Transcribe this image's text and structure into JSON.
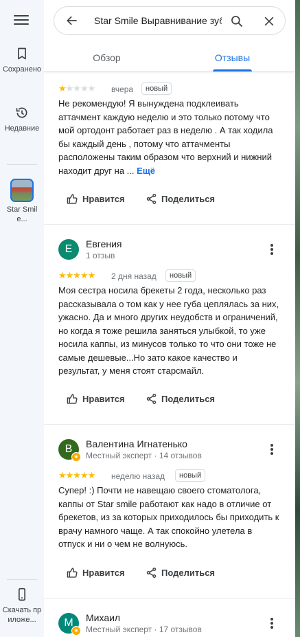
{
  "rail": {
    "saved_label": "Сохранено",
    "recent_label": "Недавние",
    "place_label": "Star Smile...",
    "download_label": "Скачать приложе..."
  },
  "search": {
    "value": "Star Smile Выравнивание зуб"
  },
  "tabs": [
    {
      "label": "Обзор",
      "active": false
    },
    {
      "label": "Отзывы",
      "active": true
    }
  ],
  "actions": {
    "like": "Нравится",
    "share": "Поделиться"
  },
  "reviews": [
    {
      "rating": 1,
      "when": "вчера",
      "tag": "новый",
      "text": "Не рекомендую! Я вынуждена подклеивать аттачмент каждую неделю и это только потому что мой ортодонт работает раз в неделю . А так ходила бы каждый день , потому что аттачменты расположены таким образом что верхний и нижний находит друг на ...",
      "more": "Ещё"
    },
    {
      "name": "Евгения",
      "initial": "Е",
      "sub": "1 отзыв",
      "rating": 5,
      "when": "2 дня назад",
      "tag": "новый",
      "text": "Моя сестра носила брекеты 2 года, несколько раз рассказывала о том как у нее губа цеплялась за них, ужасно. Да и много других неудобств и ограничений, но когда я тоже решила заняться улыбкой, то уже носила каппы, из минусов только то что они тоже не самые дешевые...Но зато какое качество и результат, у меня стоят старсмайл."
    },
    {
      "name": "Валентина Игнатенько",
      "initial": "В",
      "sub": "Местный эксперт · 14 отзывов",
      "rating": 5,
      "when": "неделю назад",
      "tag": "новый",
      "text": "Супер! :) Почти не навещаю своего стоматолога, каппы от Star smile работают как надо в отличие от брекетов, из за которых приходилось бы приходить к врачу намного чаще. А так спокойно улетела в отпуск и ни о чем не волнуюсь."
    },
    {
      "name": "Михаил",
      "initial": "М",
      "sub": "Местный эксперт · 17 отзывов"
    }
  ],
  "colors": {
    "accent": "#1a73e8",
    "star": "#fbbc04",
    "avatar_e": "#0b8a6f",
    "avatar_v": "#33691e",
    "avatar_m": "#00897b"
  }
}
